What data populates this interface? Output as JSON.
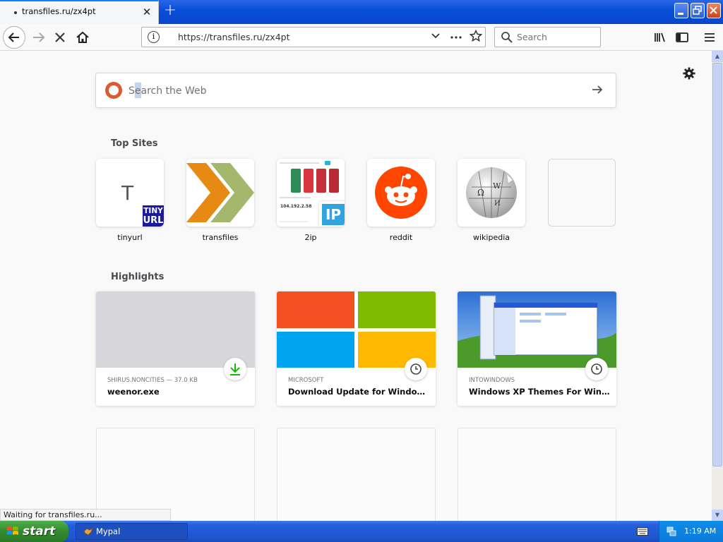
{
  "browser": {
    "tab": {
      "title": "transfiles.ru/zx4pt",
      "close": "✕"
    },
    "new_tab": "+",
    "window_buttons": {
      "minimize": "▁",
      "restore": "❐",
      "close": "✕"
    },
    "url": "https://transfiles.ru/zx4pt",
    "search_placeholder": "Search",
    "status_text": "Waiting for transfiles.ru..."
  },
  "newtab": {
    "web_search_placeholder": "Search the Web",
    "top_sites_title": "Top Sites",
    "top_sites": [
      {
        "label": "tinyurl",
        "icon_letter": "T",
        "badge_line1": "TINY",
        "badge_line2": "URL"
      },
      {
        "label": "transfiles"
      },
      {
        "label": "2ip",
        "badge": "IP",
        "screenshot_text": "104.192.2.58"
      },
      {
        "label": "reddit"
      },
      {
        "label": "wikipedia"
      }
    ],
    "highlights_title": "Highlights",
    "highlights": [
      {
        "source": "SHIRUS.NONCITIES — 37.0 KB",
        "title": "weenor.exe",
        "badge": "download-icon"
      },
      {
        "source": "MICROSOFT",
        "title": "Download Update for Windows ...",
        "badge": "clock-icon"
      },
      {
        "source": "INTOWINDOWS",
        "title": "Windows XP Themes For Windo...",
        "badge": "clock-icon"
      }
    ]
  },
  "taskbar": {
    "start_label": "start",
    "task_label": "Mypal",
    "clock": "1:19 AM"
  },
  "colors": {
    "accent": "#0a84ff",
    "xp_blue": "#245edb",
    "start_green": "#338a2d",
    "download_green": "#12bc00"
  }
}
